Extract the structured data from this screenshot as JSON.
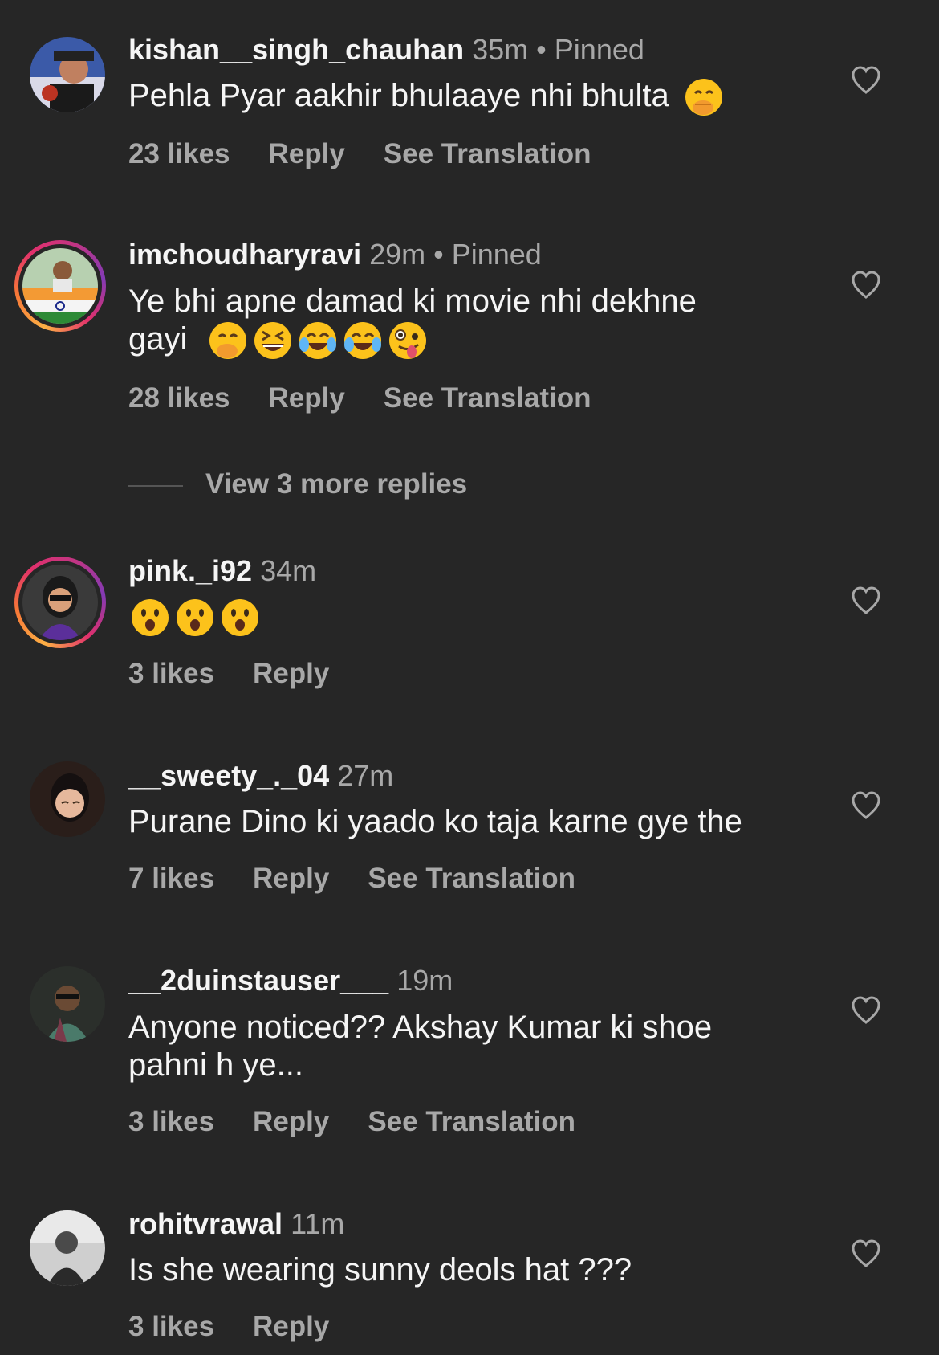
{
  "comments": [
    {
      "username": "kishan__singh_chauhan",
      "time": "35m",
      "pinned": "Pinned",
      "text": "Pehla Pyar aakhir bhulaaye nhi bhulta",
      "likes": "23 likes",
      "reply": "Reply",
      "translate": "See Translation"
    },
    {
      "username": "imchoudharyravi",
      "time": "29m",
      "pinned": "Pinned",
      "text_line1": "Ye bhi apne damad ki movie nhi dekhne",
      "text_line2": "gayi",
      "likes": "28 likes",
      "reply": "Reply",
      "translate": "See Translation"
    },
    {
      "username": "pink._i92",
      "time": "34m",
      "likes": "3 likes",
      "reply": "Reply"
    },
    {
      "username": "__sweety_._04",
      "time": "27m",
      "text": "Purane Dino ki yaado ko taja karne gye the",
      "likes": "7 likes",
      "reply": "Reply",
      "translate": "See Translation"
    },
    {
      "username": "__2duinstauser___",
      "time": "19m",
      "text_line1": "Anyone noticed?? Akshay Kumar ki shoe",
      "text_line2": "pahni h ye...",
      "likes": "3 likes",
      "reply": "Reply",
      "translate": "See Translation"
    },
    {
      "username": "rohitvrawal",
      "time": "11m",
      "text": "Is she wearing sunny deols hat ???",
      "likes": "3 likes",
      "reply": "Reply"
    }
  ],
  "view_more": "View 3 more replies",
  "icons": {
    "like": "heart-outline-icon",
    "emojis": [
      "face-with-hand-over-mouth",
      "grinning-squinting-face",
      "face-with-tears-of-joy",
      "zany-face",
      "hushed-face"
    ]
  },
  "colors": {
    "background": "#262626",
    "primary_text": "#f5f5f5",
    "secondary_text": "#a8a8a8"
  }
}
